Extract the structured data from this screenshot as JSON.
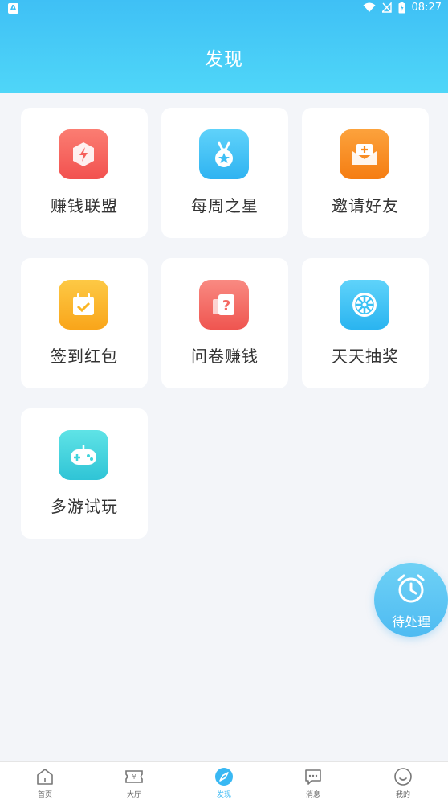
{
  "status_bar": {
    "time": "08:27",
    "left_badge": "A"
  },
  "header": {
    "title": "发现"
  },
  "features": [
    {
      "label": "赚钱联盟",
      "icon": "lightning-shield-icon",
      "color": "#f5605b"
    },
    {
      "label": "每周之星",
      "icon": "star-medal-icon",
      "color": "#3fbff5"
    },
    {
      "label": "邀请好友",
      "icon": "invitation-envelope-icon",
      "color": "#f98a1a"
    },
    {
      "label": "签到红包",
      "icon": "calendar-check-icon",
      "color": "#fbb624"
    },
    {
      "label": "问卷赚钱",
      "icon": "question-card-icon",
      "color": "#f46a63"
    },
    {
      "label": "天天抽奖",
      "icon": "lottery-wheel-icon",
      "color": "#3cc2f5"
    },
    {
      "label": "多游试玩",
      "icon": "gamepad-icon",
      "color": "#40d4dc"
    }
  ],
  "float_button": {
    "label": "待处理",
    "icon": "alarm-clock-icon"
  },
  "tabs": [
    {
      "label": "首页",
      "icon": "home-icon",
      "active": false
    },
    {
      "label": "大厅",
      "icon": "ticket-icon",
      "active": false
    },
    {
      "label": "发现",
      "icon": "compass-icon",
      "active": true
    },
    {
      "label": "消息",
      "icon": "message-icon",
      "active": false
    },
    {
      "label": "我的",
      "icon": "profile-icon",
      "active": false
    }
  ]
}
